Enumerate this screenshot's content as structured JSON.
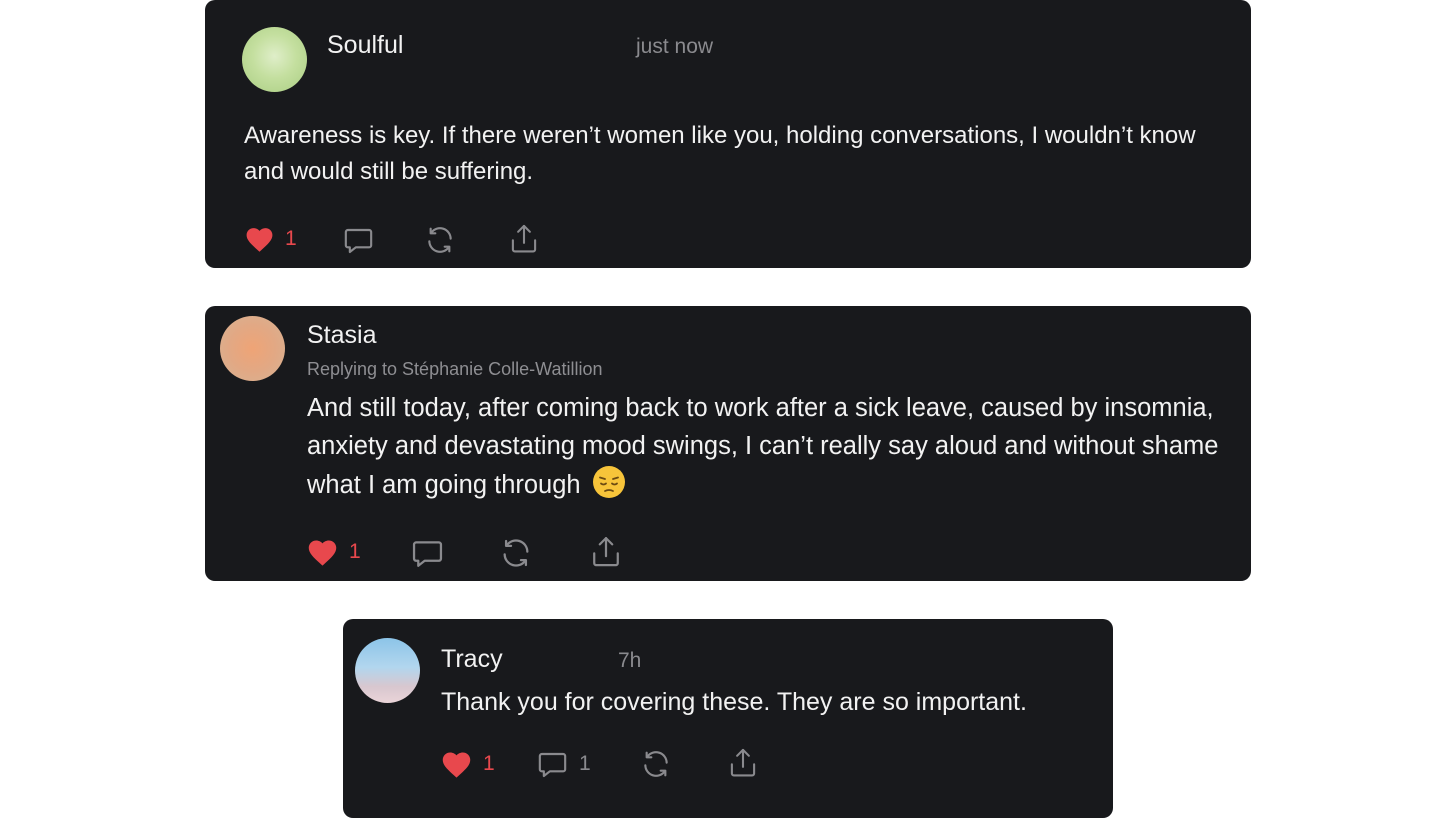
{
  "comments": [
    {
      "author": "Soulful",
      "time": "just now",
      "body": "Awareness is key. If there weren’t women like you, holding conversations, I wouldn’t know and would still be suffering.",
      "likes": "1"
    },
    {
      "author": "Stasia",
      "replying_to": "Replying to Stéphanie Colle-Watillion",
      "body": "And still today, after coming back to work after a sick leave, caused by insomnia, anxiety and devastating mood swings, I can’t really say aloud and without shame what I am going through",
      "emoji": "pensive-face-icon",
      "likes": "1"
    },
    {
      "author": "Tracy",
      "time": "7h",
      "body": "Thank you for covering these. They are so important.",
      "likes": "1",
      "replies": "1"
    }
  ],
  "colors": {
    "card_background": "#18191c",
    "page_background": "#ffffff",
    "like_red": "#e8484d",
    "muted_text": "#8a8a8e",
    "primary_text": "#f2f2f2"
  }
}
